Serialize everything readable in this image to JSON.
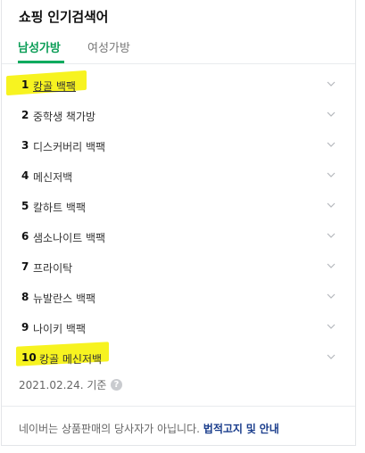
{
  "header": {
    "title": "쇼핑 인기검색어"
  },
  "tabs": [
    {
      "label": "남성가방",
      "active": true
    },
    {
      "label": "여성가방",
      "active": false
    }
  ],
  "keywords": [
    {
      "rank": "1",
      "text": "캉골 백팩"
    },
    {
      "rank": "2",
      "text": "중학생 책가방"
    },
    {
      "rank": "3",
      "text": "디스커버리 백팩"
    },
    {
      "rank": "4",
      "text": "메신저백"
    },
    {
      "rank": "5",
      "text": "칼하트 백팩"
    },
    {
      "rank": "6",
      "text": "샘소나이트 백팩"
    },
    {
      "rank": "7",
      "text": "프라이탁"
    },
    {
      "rank": "8",
      "text": "뉴발란스 백팩"
    },
    {
      "rank": "9",
      "text": "나이키 백팩"
    },
    {
      "rank": "10",
      "text": "캉골 메신저백"
    }
  ],
  "date_label": "2021.02.24. 기준",
  "help_icon": "?",
  "footer": {
    "disclaimer": "네이버는 상품판매의 당사자가 아닙니다.",
    "link1": "법적고지",
    "conj": "및",
    "link2": "안내"
  },
  "colors": {
    "accent": "#0aab5e",
    "highlight": "#f7f320",
    "link": "#1a3d8c"
  }
}
